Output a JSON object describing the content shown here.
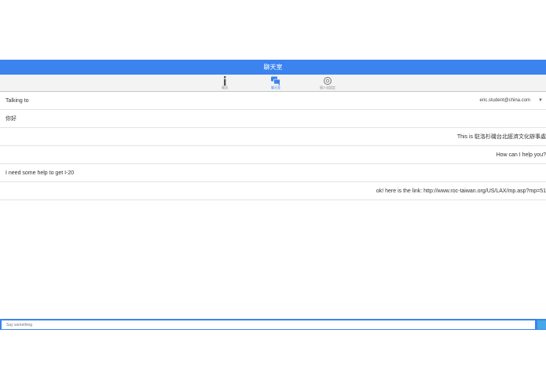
{
  "header": {
    "title": "聊天室"
  },
  "tabs": [
    {
      "label": "資訊",
      "icon": "info-icon",
      "active": false
    },
    {
      "label": "聊天室",
      "icon": "chat-icon",
      "active": true
    },
    {
      "label": "個人化設定",
      "icon": "gear-icon",
      "active": false
    }
  ],
  "talking_to": {
    "label": "Talking to",
    "selected": "eric.student@china.com"
  },
  "messages": [
    {
      "text": "你好",
      "side": "left"
    },
    {
      "text": "This is 駐洛杉磯台北經濟文化辦事處",
      "side": "right"
    },
    {
      "text": "How can I help you?",
      "side": "right"
    },
    {
      "text": "I need some help to get I-20",
      "side": "left"
    },
    {
      "text": "ok! here is the link: http://www.roc-taiwan.org/US/LAX/mp.asp?mp=51",
      "side": "right"
    }
  ],
  "composer": {
    "placeholder": "Say something"
  },
  "colors": {
    "accent": "#3b83ef",
    "send_button": "#46a8e6"
  }
}
